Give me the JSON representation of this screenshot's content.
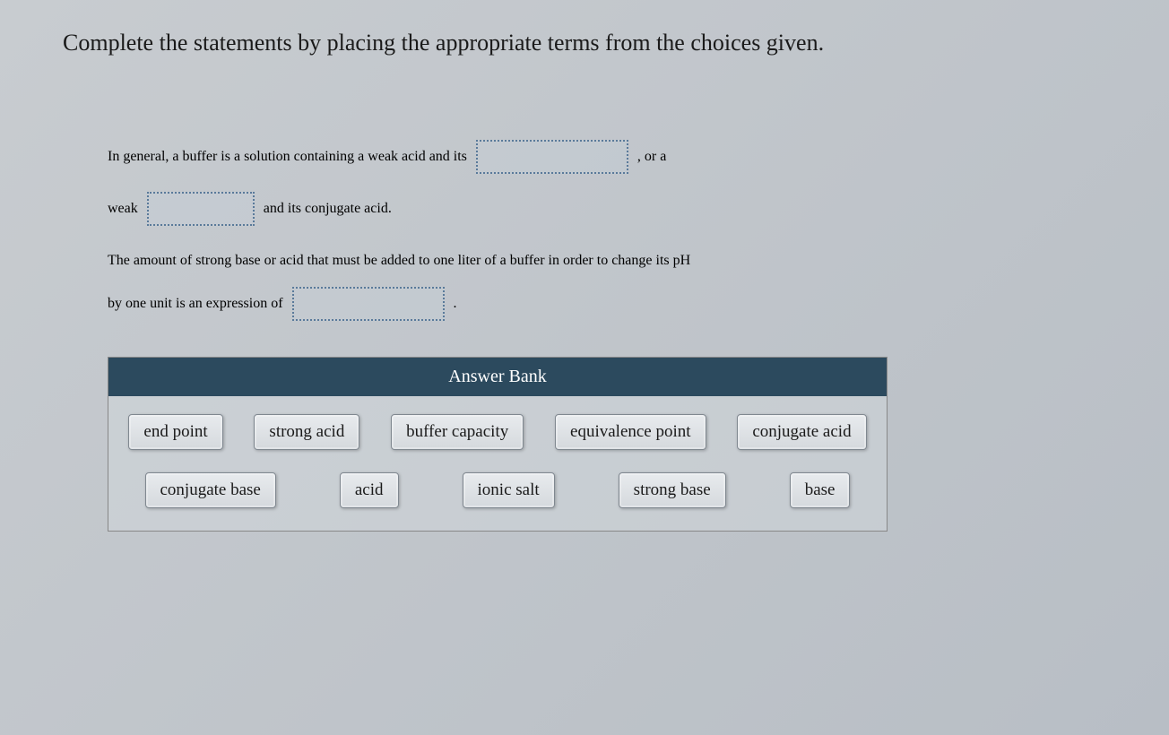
{
  "instruction": "Complete the statements by placing the appropriate terms from the choices given.",
  "statement": {
    "seg1": "In general, a buffer is a solution containing a weak acid and its",
    "seg2": ", or a",
    "seg3": "weak",
    "seg4": "and its conjugate acid.",
    "seg5": "The amount of strong base or acid that must be added to one liter of a buffer in order to change its pH",
    "seg6": "by one unit is an expression of",
    "seg7": "."
  },
  "answer_bank": {
    "title": "Answer Bank",
    "row1": [
      "end point",
      "strong acid",
      "buffer capacity",
      "equivalence point",
      "conjugate acid"
    ],
    "row2": [
      "conjugate base",
      "acid",
      "ionic salt",
      "strong base",
      "base"
    ]
  }
}
